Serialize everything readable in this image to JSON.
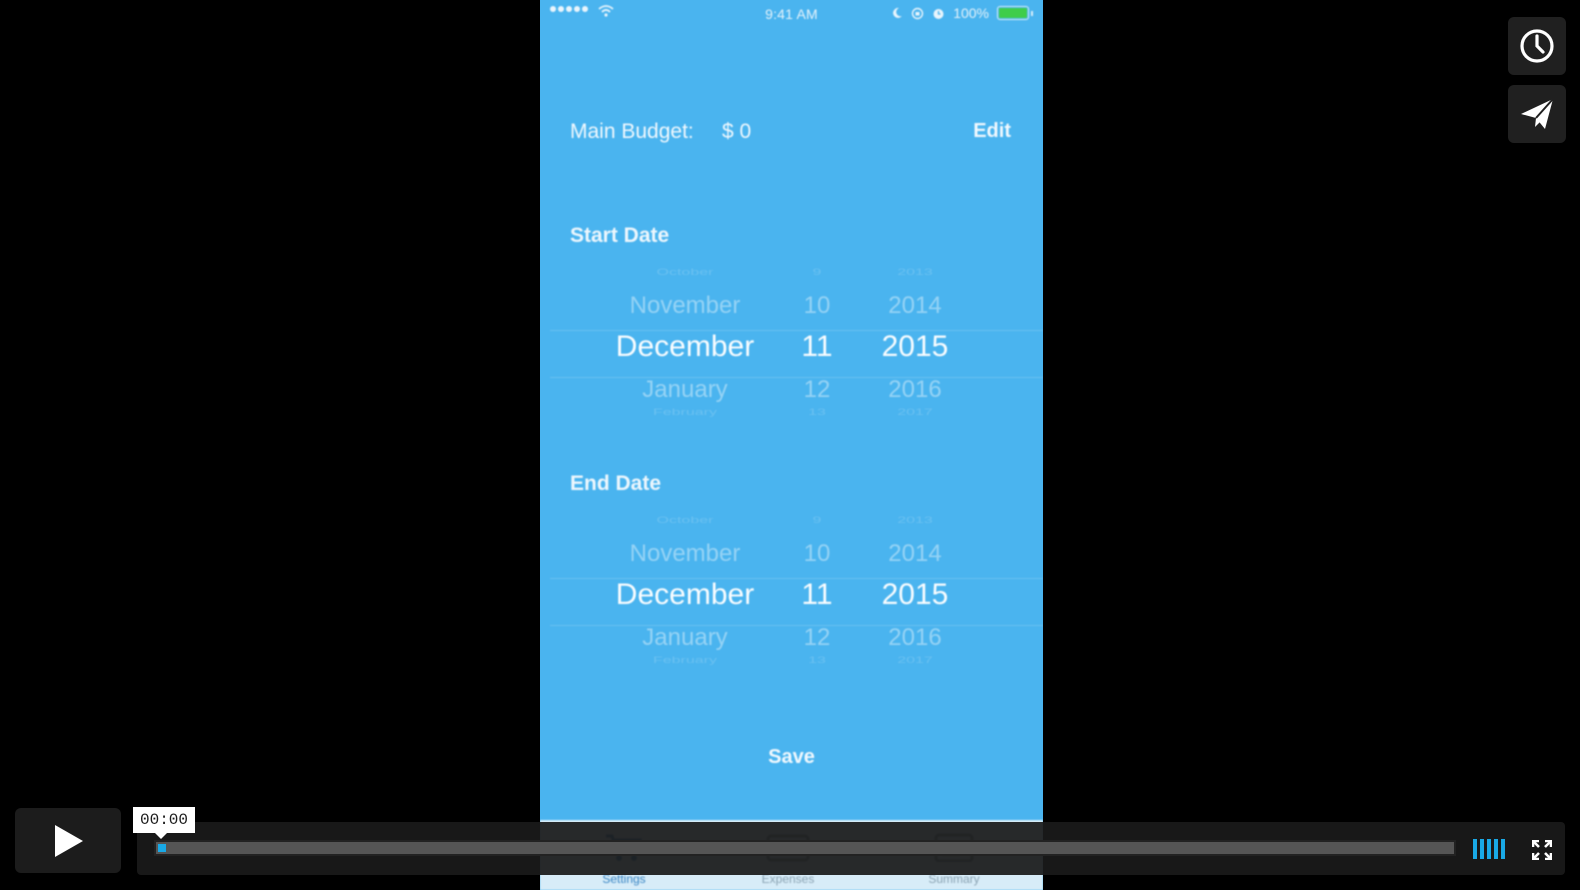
{
  "status_bar": {
    "time": "9:41 AM",
    "battery_percent": "100%",
    "battery_level": 1.0,
    "icons": [
      "signal-dots-icon",
      "wifi-icon",
      "moon-icon",
      "rotation-lock-icon",
      "alarm-icon",
      "battery-icon"
    ]
  },
  "budget": {
    "label": "Main Budget:",
    "amount": "$ 0",
    "edit_label": "Edit"
  },
  "start_date": {
    "title": "Start Date",
    "month": {
      "edge_prev": "October",
      "prev": "November",
      "selected": "December",
      "next": "January",
      "edge_next": "February"
    },
    "day": {
      "edge_prev": "9",
      "prev": "10",
      "selected": "11",
      "next": "12",
      "edge_next": "13"
    },
    "year": {
      "edge_prev": "2013",
      "prev": "2014",
      "selected": "2015",
      "next": "2016",
      "edge_next": "2017"
    }
  },
  "end_date": {
    "title": "End Date",
    "month": {
      "edge_prev": "October",
      "prev": "November",
      "selected": "December",
      "next": "January",
      "edge_next": "February"
    },
    "day": {
      "edge_prev": "9",
      "prev": "10",
      "selected": "11",
      "next": "12",
      "edge_next": "13"
    },
    "year": {
      "edge_prev": "2013",
      "prev": "2014",
      "selected": "2015",
      "next": "2016",
      "edge_next": "2017"
    }
  },
  "save_label": "Save",
  "tabs": [
    {
      "label": "Settings",
      "icon": "cart-icon",
      "active": true
    },
    {
      "label": "Expenses",
      "icon": "card-icon",
      "active": false
    },
    {
      "label": "Summary",
      "icon": "list-icon",
      "active": false
    }
  ],
  "player": {
    "current_time": "00:00",
    "progress": 0.005,
    "accent_color": "#19a9e6",
    "side_buttons": [
      "watch-later-clock-icon",
      "share-paper-plane-icon"
    ],
    "play_icon": "play-icon",
    "volume_icon": "volume-bars-icon",
    "fullscreen_icon": "fullscreen-icon"
  },
  "colors": {
    "screen_background": "#4ab4ef",
    "tab_bar": "#d7ecf8"
  }
}
